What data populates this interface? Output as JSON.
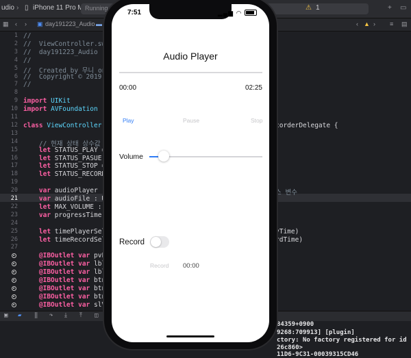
{
  "xcode": {
    "breadcrumb_left": "udio",
    "device": "iPhone 11 Pro Max",
    "activity": "Running d",
    "jumpbar": "day191223_Audio",
    "console_lines": [
      "84359+0900",
      "9268:709913] [plugin]",
      "ctory: No factory registered for id",
      "26c860>",
      "11D6-9C31-00039315CD46"
    ],
    "right_fragments": {
      "l12": "corderDelegate {",
      "l19": "스 변수",
      "l25": "yTime)",
      "l26": "rdTime)"
    }
  },
  "code_lines": [
    {
      "n": "1",
      "t": "//"
    },
    {
      "n": "2",
      "t": "//  ViewController.swif"
    },
    {
      "n": "3",
      "t": "//  day191223_Audio"
    },
    {
      "n": "4",
      "t": "//"
    },
    {
      "n": "5",
      "t": "//  Created by 무니 on 2"
    },
    {
      "n": "6",
      "t": "//  Copyright © 2019 co"
    },
    {
      "n": "7",
      "t": "//"
    },
    {
      "n": "8",
      "t": ""
    },
    {
      "n": "9",
      "t": "import UIKit"
    },
    {
      "n": "10",
      "t": "import AVFoundation"
    },
    {
      "n": "11",
      "t": ""
    },
    {
      "n": "12",
      "t": "class ViewController: U"
    },
    {
      "n": "13",
      "t": ""
    },
    {
      "n": "14",
      "t": "    // 현재 상태 상수값"
    },
    {
      "n": "15",
      "t": "    let STATUS_PLAY = 0"
    },
    {
      "n": "16",
      "t": "    let STATUS_PASUE ="
    },
    {
      "n": "17",
      "t": "    let STATUS_STOP = 2"
    },
    {
      "n": "18",
      "t": "    let STATUS_RECORD ="
    },
    {
      "n": "19",
      "t": ""
    },
    {
      "n": "20",
      "t": "    var audioPlayer : A"
    },
    {
      "n": "21",
      "t": "    var audioFile : URL"
    },
    {
      "n": "22",
      "t": "    let MAX_VOLUME : Fl"
    },
    {
      "n": "23",
      "t": "    var progressTimer :"
    },
    {
      "n": "24",
      "t": ""
    },
    {
      "n": "25",
      "t": "    let timePlayerSelec"
    },
    {
      "n": "26",
      "t": "    let timeRecordSelec"
    },
    {
      "n": "27",
      "t": ""
    },
    {
      "n": "",
      "t": "    @IBOutlet var pvPro"
    },
    {
      "n": "",
      "t": "    @IBOutlet var lblCu"
    },
    {
      "n": "",
      "t": "    @IBOutlet var lblEn"
    },
    {
      "n": "",
      "t": "    @IBOutlet var btnPl"
    },
    {
      "n": "",
      "t": "    @IBOutlet var btnPa"
    },
    {
      "n": "",
      "t": "    @IBOutlet var btnSt"
    },
    {
      "n": "",
      "t": "    @IBOutlet var slVol"
    }
  ],
  "phone": {
    "status_time": "7:51",
    "title": "Audio Player",
    "current_time": "00:00",
    "end_time": "02:25",
    "play_label": "Play",
    "pause_label": "Pause",
    "stop_label": "Stop",
    "volume_label": "Volume",
    "volume_level": 0.13,
    "record_label": "Record",
    "record_toggle_on": false,
    "record_button_label": "Record",
    "record_time": "00:00",
    "accent_color": "#2f7cf6"
  }
}
